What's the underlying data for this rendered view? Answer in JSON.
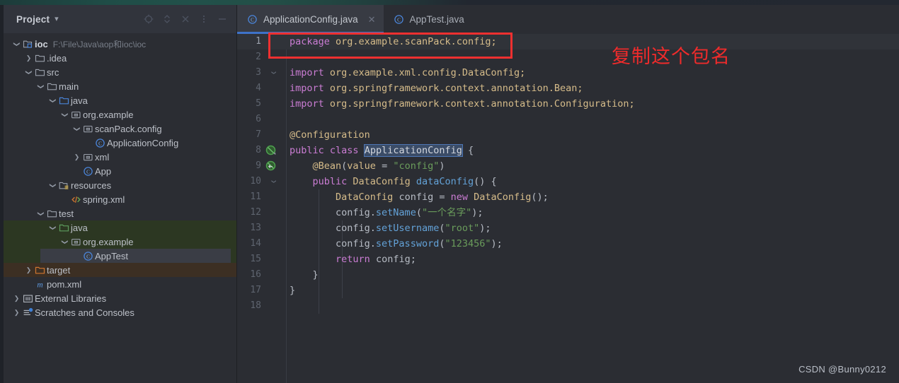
{
  "window": {
    "accent_color": "#3e72c9",
    "background": "#2b2d33"
  },
  "project_panel": {
    "title": "Project",
    "caret_icon": "chevron-down-icon",
    "tools": [
      {
        "name": "locate-icon",
        "label": "Select Opened File"
      },
      {
        "name": "collapse-expand-icon",
        "label": "Expand / Collapse"
      },
      {
        "name": "close-icon",
        "label": "Hide"
      },
      {
        "name": "more-options-icon",
        "label": "Options"
      },
      {
        "name": "minimize-icon",
        "label": "Minimize"
      }
    ],
    "tree": [
      {
        "label": "ioc",
        "sub": "F:\\File\\Java\\aop和ioc\\ioc",
        "icon": "module-folder-icon",
        "indent": 0,
        "caret": "expanded",
        "bold": true,
        "bg": "none"
      },
      {
        "label": ".idea",
        "sub": "",
        "icon": "folder-icon",
        "indent": 1,
        "caret": "collapsed",
        "bold": false,
        "bg": "none"
      },
      {
        "label": "src",
        "sub": "",
        "icon": "folder-icon",
        "indent": 1,
        "caret": "expanded",
        "bold": false,
        "bg": "none"
      },
      {
        "label": "main",
        "sub": "",
        "icon": "folder-icon",
        "indent": 2,
        "caret": "expanded",
        "bold": false,
        "bg": "none"
      },
      {
        "label": "java",
        "sub": "",
        "icon": "source-folder-icon",
        "indent": 3,
        "caret": "expanded",
        "bold": false,
        "bg": "none"
      },
      {
        "label": "org.example",
        "sub": "",
        "icon": "package-icon",
        "indent": 4,
        "caret": "expanded",
        "bold": false,
        "bg": "none"
      },
      {
        "label": "scanPack.config",
        "sub": "",
        "icon": "package-icon",
        "indent": 5,
        "caret": "expanded",
        "bold": false,
        "bg": "none"
      },
      {
        "label": "ApplicationConfig",
        "sub": "",
        "icon": "java-class-icon",
        "indent": 6,
        "caret": "none",
        "bold": false,
        "bg": "none"
      },
      {
        "label": "xml",
        "sub": "",
        "icon": "package-icon",
        "indent": 5,
        "caret": "collapsed",
        "bold": false,
        "bg": "none"
      },
      {
        "label": "App",
        "sub": "",
        "icon": "java-class-icon",
        "indent": 5,
        "caret": "none",
        "bold": false,
        "bg": "none"
      },
      {
        "label": "resources",
        "sub": "",
        "icon": "resource-folder-icon",
        "indent": 3,
        "caret": "expanded",
        "bold": false,
        "bg": "none"
      },
      {
        "label": "spring.xml",
        "sub": "",
        "icon": "xml-file-icon",
        "indent": 4,
        "caret": "none",
        "bold": false,
        "bg": "none"
      },
      {
        "label": "test",
        "sub": "",
        "icon": "folder-icon",
        "indent": 2,
        "caret": "expanded",
        "bold": false,
        "bg": "none"
      },
      {
        "label": "java",
        "sub": "",
        "icon": "test-source-folder-icon",
        "indent": 3,
        "caret": "expanded",
        "bold": false,
        "bg": "green"
      },
      {
        "label": "org.example",
        "sub": "",
        "icon": "package-icon",
        "indent": 4,
        "caret": "expanded",
        "bold": false,
        "bg": "green"
      },
      {
        "label": "AppTest",
        "sub": "",
        "icon": "java-class-icon",
        "indent": 5,
        "caret": "none",
        "bold": false,
        "bg": "green-selected"
      },
      {
        "label": "target",
        "sub": "",
        "icon": "excluded-folder-icon",
        "indent": 1,
        "caret": "collapsed",
        "bold": false,
        "bg": "brown"
      },
      {
        "label": "pom.xml",
        "sub": "",
        "icon": "maven-icon",
        "indent": 1,
        "caret": "none",
        "bold": false,
        "bg": "none"
      },
      {
        "label": "External Libraries",
        "sub": "",
        "icon": "library-icon",
        "indent": 0,
        "caret": "collapsed",
        "bold": false,
        "bg": "none"
      },
      {
        "label": "Scratches and Consoles",
        "sub": "",
        "icon": "scratches-icon",
        "indent": 0,
        "caret": "collapsed",
        "bold": false,
        "bg": "none"
      }
    ]
  },
  "editor": {
    "tabs": [
      {
        "label": "ApplicationConfig.java",
        "icon": "java-class-icon",
        "active": true,
        "closable": true
      },
      {
        "label": "AppTest.java",
        "icon": "java-class-icon",
        "active": false,
        "closable": false
      }
    ],
    "close_icon": "close-icon",
    "lines": [
      {
        "n": "1",
        "current": true,
        "fold": "",
        "gutter_icon": "",
        "segments": [
          {
            "t": "package ",
            "c": "kw"
          },
          {
            "t": "org.example.scanPack.config;",
            "c": "pkg"
          }
        ]
      },
      {
        "n": "2",
        "current": false,
        "fold": "",
        "gutter_icon": "",
        "segments": []
      },
      {
        "n": "3",
        "current": false,
        "fold": "expanded",
        "gutter_icon": "",
        "segments": [
          {
            "t": "import ",
            "c": "kw"
          },
          {
            "t": "org.example.xml.config.DataConfig;",
            "c": "pkg"
          }
        ]
      },
      {
        "n": "4",
        "current": false,
        "fold": "",
        "gutter_icon": "",
        "segments": [
          {
            "t": "import ",
            "c": "kw"
          },
          {
            "t": "org.springframework.context.annotation.Bean;",
            "c": "pkg"
          }
        ]
      },
      {
        "n": "5",
        "current": false,
        "fold": "",
        "gutter_icon": "",
        "segments": [
          {
            "t": "import ",
            "c": "kw"
          },
          {
            "t": "org.springframework.context.annotation.Configuration;",
            "c": "pkg"
          }
        ]
      },
      {
        "n": "6",
        "current": false,
        "fold": "",
        "gutter_icon": "",
        "segments": []
      },
      {
        "n": "7",
        "current": false,
        "fold": "",
        "gutter_icon": "",
        "segments": [
          {
            "t": "@Configuration",
            "c": "ann"
          }
        ]
      },
      {
        "n": "8",
        "current": false,
        "fold": "",
        "gutter_icon": "spring-bean-icon",
        "segments": [
          {
            "t": "public ",
            "c": "kw"
          },
          {
            "t": "class ",
            "c": "kw"
          },
          {
            "t": "ApplicationConfig",
            "c": "sel-tok"
          },
          {
            "t": " {",
            "c": "pl"
          }
        ]
      },
      {
        "n": "9",
        "current": false,
        "fold": "",
        "gutter_icon": "spring-bean-nav-icon",
        "segments": [
          {
            "t": "    ",
            "c": "pl"
          },
          {
            "t": "@Bean",
            "c": "ann"
          },
          {
            "t": "(",
            "c": "pl"
          },
          {
            "t": "value",
            "c": "ann"
          },
          {
            "t": " = ",
            "c": "pl"
          },
          {
            "t": "\"config\"",
            "c": "strg"
          },
          {
            "t": ")",
            "c": "pl"
          }
        ]
      },
      {
        "n": "10",
        "current": false,
        "fold": "expanded",
        "gutter_icon": "",
        "segments": [
          {
            "t": "    ",
            "c": "pl"
          },
          {
            "t": "public ",
            "c": "kw"
          },
          {
            "t": "DataConfig ",
            "c": "typ"
          },
          {
            "t": "dataConfig",
            "c": "mtd"
          },
          {
            "t": "() {",
            "c": "pl"
          }
        ]
      },
      {
        "n": "11",
        "current": false,
        "fold": "",
        "gutter_icon": "",
        "segments": [
          {
            "t": "        ",
            "c": "pl"
          },
          {
            "t": "DataConfig",
            "c": "typ"
          },
          {
            "t": " config = ",
            "c": "pl"
          },
          {
            "t": "new ",
            "c": "kw"
          },
          {
            "t": "DataConfig",
            "c": "typ"
          },
          {
            "t": "();",
            "c": "pl"
          }
        ]
      },
      {
        "n": "12",
        "current": false,
        "fold": "",
        "gutter_icon": "",
        "segments": [
          {
            "t": "        config.",
            "c": "pl"
          },
          {
            "t": "setName",
            "c": "mtd"
          },
          {
            "t": "(",
            "c": "pl"
          },
          {
            "t": "\"一个名字\"",
            "c": "strg"
          },
          {
            "t": ");",
            "c": "pl"
          }
        ]
      },
      {
        "n": "13",
        "current": false,
        "fold": "",
        "gutter_icon": "",
        "segments": [
          {
            "t": "        config.",
            "c": "pl"
          },
          {
            "t": "setUsername",
            "c": "mtd"
          },
          {
            "t": "(",
            "c": "pl"
          },
          {
            "t": "\"root\"",
            "c": "strg"
          },
          {
            "t": ");",
            "c": "pl"
          }
        ]
      },
      {
        "n": "14",
        "current": false,
        "fold": "",
        "gutter_icon": "",
        "segments": [
          {
            "t": "        config.",
            "c": "pl"
          },
          {
            "t": "setPassword",
            "c": "mtd"
          },
          {
            "t": "(",
            "c": "pl"
          },
          {
            "t": "\"123456\"",
            "c": "strg"
          },
          {
            "t": ");",
            "c": "pl"
          }
        ]
      },
      {
        "n": "15",
        "current": false,
        "fold": "",
        "gutter_icon": "",
        "segments": [
          {
            "t": "        ",
            "c": "pl"
          },
          {
            "t": "return ",
            "c": "kw"
          },
          {
            "t": "config;",
            "c": "pl"
          }
        ]
      },
      {
        "n": "16",
        "current": false,
        "fold": "",
        "gutter_icon": "",
        "segments": [
          {
            "t": "    }",
            "c": "pl"
          }
        ]
      },
      {
        "n": "17",
        "current": false,
        "fold": "",
        "gutter_icon": "",
        "segments": [
          {
            "t": "}",
            "c": "pl"
          }
        ]
      },
      {
        "n": "18",
        "current": false,
        "fold": "",
        "gutter_icon": "",
        "segments": []
      }
    ]
  },
  "annotations": {
    "highlight_box_color": "#f03030",
    "note_text": "复制这个包名",
    "note_color": "#ee2b2b"
  },
  "watermark": {
    "text": "CSDN @Bunny0212"
  }
}
